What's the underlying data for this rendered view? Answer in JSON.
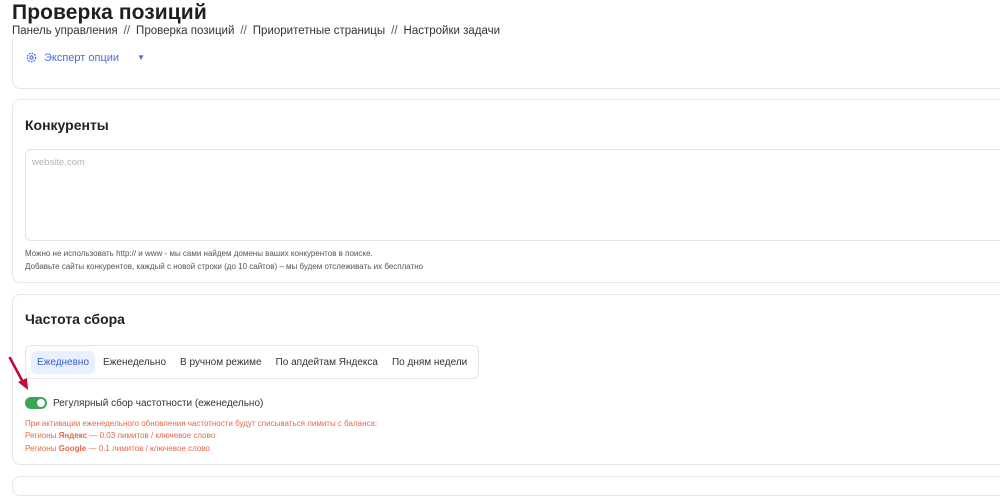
{
  "page": {
    "title": "Проверка позиций",
    "breadcrumb": [
      "Панель управления",
      "Проверка позиций",
      "Приоритетные страницы",
      "Настройки задачи"
    ],
    "breadcrumb_separator": "//"
  },
  "expert": {
    "label": "Эксперт опции"
  },
  "competitors": {
    "title": "Конкуренты",
    "placeholder": "website.com",
    "hint_line1": "Можно не использовать http:// и www - мы сами найдем домены ваших конкурентов в поиске.",
    "hint_line2": "Добавьте сайты конкурентов, каждый с новой строки (до 10 сайтов) – мы будем отслеживать их бесплатно"
  },
  "frequency": {
    "title": "Частота сбора",
    "tabs": [
      "Ежедневно",
      "Еженедельно",
      "В ручном режиме",
      "По апдейтам Яндекса",
      "По дням недели"
    ],
    "active_tab": "Ежедневно",
    "switch_label": "Регулярный сбор частотности (еженедельно)",
    "switch_on": true,
    "warning_line1": "При активации еженедельного обновления частотности будут списываться лимиты с баланса:",
    "warning_yandex_prefix": "Регионы",
    "warning_yandex_engine": "Яндекс",
    "warning_yandex_suffix": "— 0.03 лимитов / ключевое слово",
    "warning_google_prefix": "Регионы",
    "warning_google_engine": "Google",
    "warning_google_suffix": "— 0.1 лимитов / ключевое слово"
  },
  "colors": {
    "accent": "#4a6cd6",
    "annotation": "#c30a3a",
    "switch_on": "#3aa655",
    "warning": "#e9674a"
  }
}
